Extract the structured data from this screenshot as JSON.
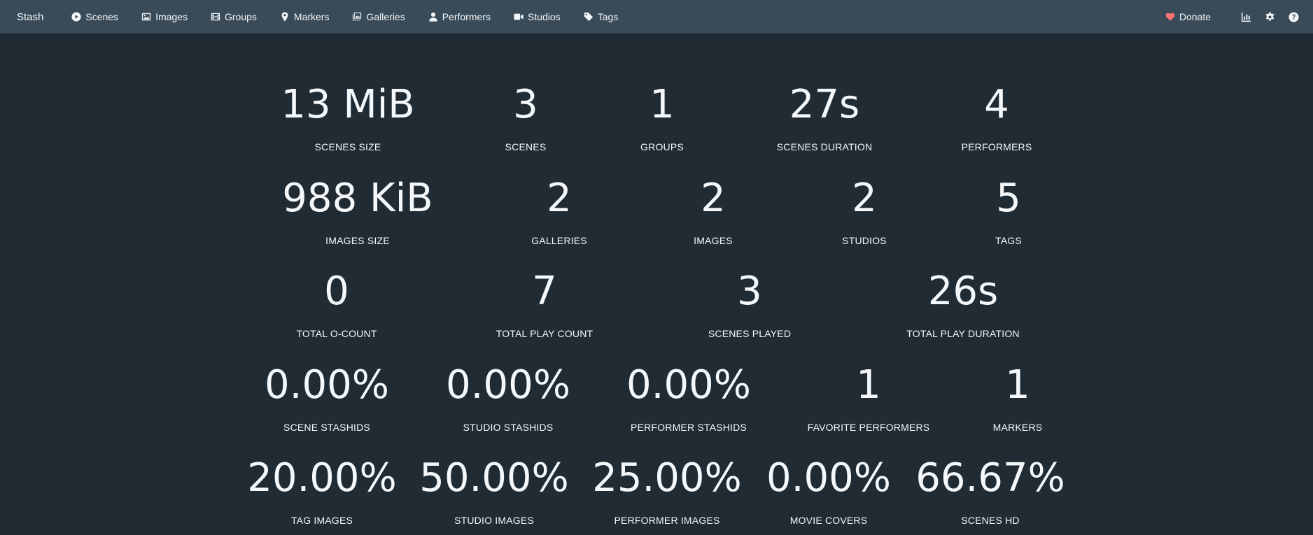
{
  "nav": {
    "brand": "Stash",
    "items": [
      {
        "label": "Scenes",
        "icon": "play-circle-icon"
      },
      {
        "label": "Images",
        "icon": "image-icon"
      },
      {
        "label": "Groups",
        "icon": "film-icon"
      },
      {
        "label": "Markers",
        "icon": "map-marker-icon"
      },
      {
        "label": "Galleries",
        "icon": "images-icon"
      },
      {
        "label": "Performers",
        "icon": "user-icon"
      },
      {
        "label": "Studios",
        "icon": "video-icon"
      },
      {
        "label": "Tags",
        "icon": "tag-icon"
      }
    ],
    "donate": "Donate",
    "right_icons": [
      "chart-icon",
      "gear-icon",
      "help-icon"
    ],
    "donate_color": "#ff7373",
    "bar_color": "#394b59"
  },
  "stats": {
    "row1": [
      {
        "value": "13 MiB",
        "label": "SCENES SIZE"
      },
      {
        "value": "3",
        "label": "SCENES"
      },
      {
        "value": "1",
        "label": "GROUPS"
      },
      {
        "value": "27s",
        "label": "SCENES DURATION"
      },
      {
        "value": "4",
        "label": "PERFORMERS"
      }
    ],
    "row2": [
      {
        "value": "988 KiB",
        "label": "IMAGES SIZE"
      },
      {
        "value": "2",
        "label": "GALLERIES"
      },
      {
        "value": "2",
        "label": "IMAGES"
      },
      {
        "value": "2",
        "label": "STUDIOS"
      },
      {
        "value": "5",
        "label": "TAGS"
      }
    ],
    "row3": [
      {
        "value": "0",
        "label": "TOTAL O-COUNT"
      },
      {
        "value": "7",
        "label": "TOTAL PLAY COUNT"
      },
      {
        "value": "3",
        "label": "SCENES PLAYED"
      },
      {
        "value": "26s",
        "label": "TOTAL PLAY DURATION"
      }
    ],
    "row4": [
      {
        "value": "0.00%",
        "label": "SCENE STASHIDS"
      },
      {
        "value": "0.00%",
        "label": "STUDIO STASHIDS"
      },
      {
        "value": "0.00%",
        "label": "PERFORMER STASHIDS"
      },
      {
        "value": "1",
        "label": "FAVORITE PERFORMERS"
      },
      {
        "value": "1",
        "label": "MARKERS"
      }
    ],
    "row5": [
      {
        "value": "20.00%",
        "label": "TAG IMAGES"
      },
      {
        "value": "50.00%",
        "label": "STUDIO IMAGES"
      },
      {
        "value": "25.00%",
        "label": "PERFORMER IMAGES"
      },
      {
        "value": "0.00%",
        "label": "MOVIE COVERS"
      },
      {
        "value": "66.67%",
        "label": "SCENES HD"
      }
    ]
  }
}
